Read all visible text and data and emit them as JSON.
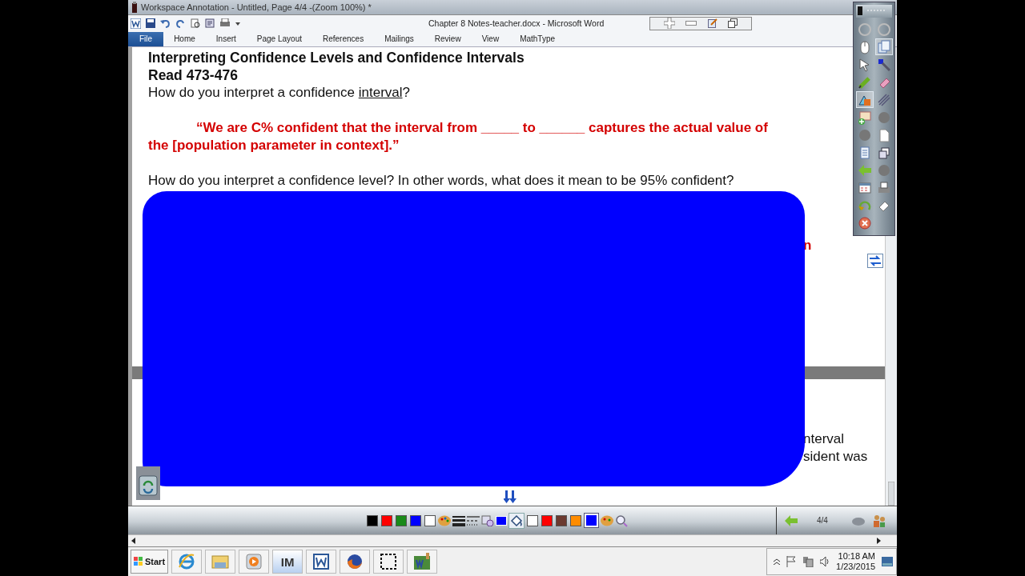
{
  "title_bar": {
    "title": "Workspace Annotation - Untitled, Page 4/4 -(Zoom 100%) *"
  },
  "word": {
    "title": "Chapter 8 Notes-teacher.docx  -  Microsoft Word",
    "tabs": [
      {
        "label": "File",
        "selected": true
      },
      {
        "label": "Home",
        "selected": false
      },
      {
        "label": "Insert",
        "selected": false
      },
      {
        "label": "Page Layout",
        "selected": false
      },
      {
        "label": "References",
        "selected": false
      },
      {
        "label": "Mailings",
        "selected": false
      },
      {
        "label": "Review",
        "selected": false
      },
      {
        "label": "View",
        "selected": false
      },
      {
        "label": "MathType",
        "selected": false
      }
    ]
  },
  "document": {
    "heading": "Interpreting Confidence Levels and Confidence Intervals",
    "subheading": "Read 473-476",
    "question": {
      "before": "How do you interpret a confidence ",
      "underlined": "interval",
      "after": "?"
    },
    "quote": "“We are C% confident that the interval from _____ to ______ captures the actual value of the [population parameter in context].”",
    "level_question": "How do you interpret a confidence level?  In other words, what does it mean to be 95% confident?",
    "fragments": [
      {
        "kind": "red",
        "text": "n"
      },
      {
        "kind": "plain",
        "text": "nterval"
      },
      {
        "kind": "plain",
        "text": "sident was"
      }
    ]
  },
  "annotation_tools": [
    {
      "selected": false
    },
    {
      "selected": false
    },
    {
      "selected": false
    },
    {
      "selected": true
    },
    {
      "selected": false
    },
    {
      "selected": false
    },
    {
      "selected": false
    },
    {
      "selected": false
    },
    {
      "selected": true
    },
    {
      "selected": false
    },
    {
      "selected": false
    },
    {
      "selected": false
    },
    {
      "selected": false
    },
    {
      "selected": false
    },
    {
      "selected": false
    },
    {
      "selected": false
    },
    {
      "selected": false
    },
    {
      "selected": false
    },
    {
      "selected": false
    },
    {
      "selected": false
    },
    {
      "selected": false
    },
    {
      "selected": false
    },
    {
      "selected": false
    }
  ],
  "toolbar": {
    "pen_colors": [
      {
        "color": "#000000",
        "selected": false
      },
      {
        "color": "#ff0000",
        "selected": false
      },
      {
        "color": "#1a8a1a",
        "selected": false
      },
      {
        "color": "#0000ff",
        "selected": false
      },
      {
        "color": "#ffffff",
        "selected": false
      }
    ],
    "fill_tool": {
      "selected": true
    },
    "fill_colors": [
      {
        "color": "#ffffff",
        "selected": false
      },
      {
        "color": "#ff0000",
        "selected": false
      },
      {
        "color": "#6b3a30",
        "selected": false
      },
      {
        "color": "#ff8c00",
        "selected": false
      },
      {
        "color": "#0000ff",
        "selected": true
      }
    ],
    "page": "4/4"
  },
  "taskbar": {
    "start": "Start",
    "quick_icons": [
      "IM"
    ],
    "time": "10:18 AM",
    "date": "1/23/2015"
  }
}
